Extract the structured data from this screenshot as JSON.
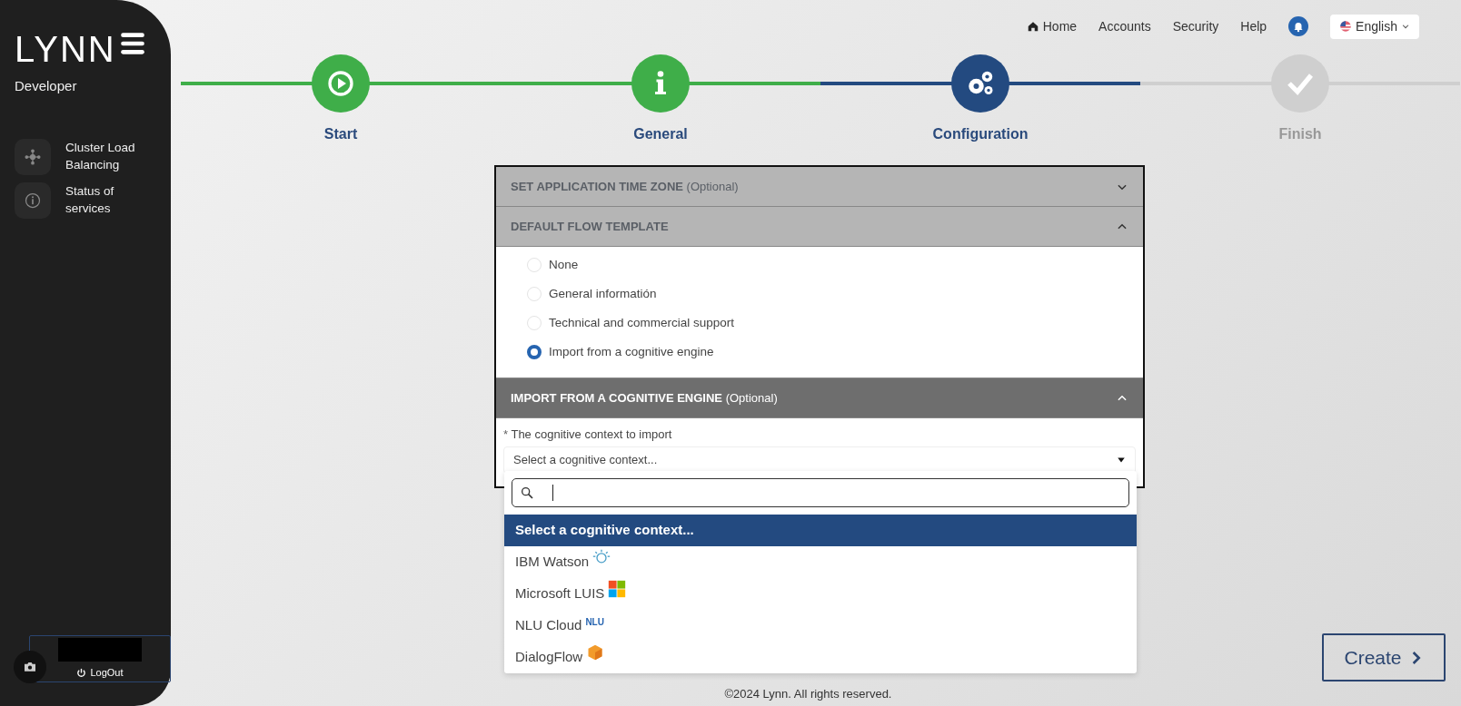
{
  "sidebar": {
    "logo": "LYNN",
    "role": "Developer",
    "items": [
      {
        "label": "Cluster Load Balancing"
      },
      {
        "label": "Status of services"
      }
    ],
    "logout": "LogOut"
  },
  "topnav": {
    "links": [
      {
        "label": "Home"
      },
      {
        "label": "Accounts"
      },
      {
        "label": "Security"
      },
      {
        "label": "Help"
      }
    ],
    "language": "English"
  },
  "steps": [
    {
      "label": "Start",
      "done": true,
      "selected": false
    },
    {
      "label": "General",
      "done": true,
      "selected": false
    },
    {
      "label": "Configuration",
      "done": false,
      "selected": true
    },
    {
      "label": "Finish",
      "done": false,
      "selected": false
    }
  ],
  "sections": [
    {
      "title": "SET APPLICATION TIME ZONE",
      "note": "(Optional)",
      "expanded": false,
      "active": false
    },
    {
      "title": "DEFAULT FLOW TEMPLATE",
      "expanded": true,
      "active": false,
      "options": [
        {
          "label": "None",
          "selected": false
        },
        {
          "label": "General informatión",
          "selected": false
        },
        {
          "label": "Technical and commercial support",
          "selected": false
        },
        {
          "label": "Import from a cognitive engine",
          "selected": true
        }
      ]
    },
    {
      "title": "IMPORT FROM A COGNITIVE ENGINE",
      "note": "(Optional)",
      "expanded": true,
      "active": true,
      "field": {
        "required_mark": "*",
        "label": "The cognitive context to import",
        "value": "Select a cognitive context...",
        "open": true
      }
    }
  ],
  "dropdown": {
    "options": [
      {
        "label": "Select a cognitive context...",
        "selected": true
      },
      {
        "label": "IBM Watson",
        "selected": false
      },
      {
        "label": "Microsoft LUIS",
        "selected": false
      },
      {
        "label": "NLU Cloud",
        "logo_text": "NLU",
        "selected": false
      },
      {
        "label": "DialogFlow",
        "selected": false
      }
    ]
  },
  "create_button": "Create",
  "footer": "©2024 Lynn. All rights reserved."
}
